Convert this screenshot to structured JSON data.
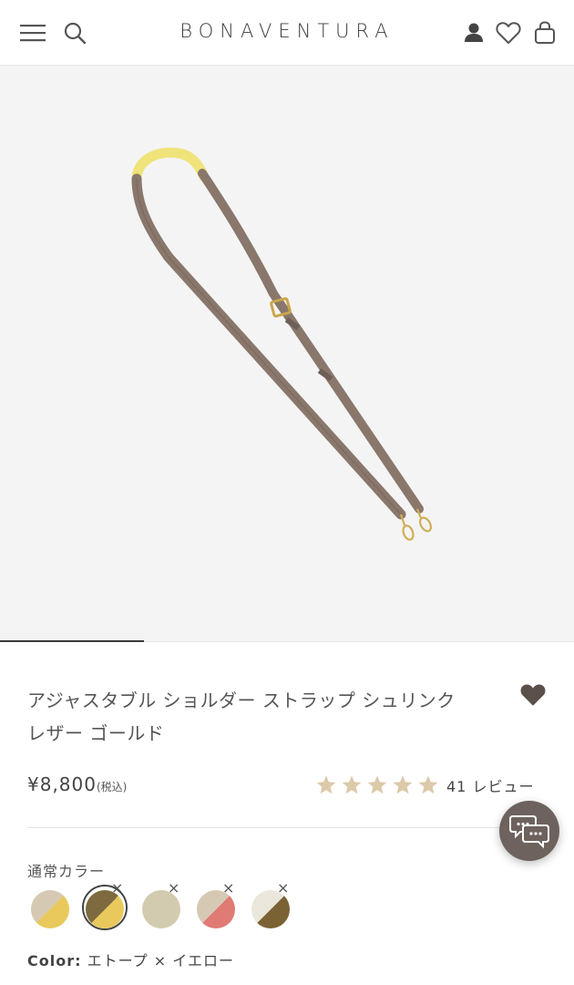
{
  "header": {
    "brand": "BONAVENTURA",
    "icons": [
      "menu-icon",
      "search-icon",
      "account-icon",
      "heart-icon",
      "bag-icon"
    ]
  },
  "gallery": {
    "image_alt": "shoulder strap in etoupe with yellow lining",
    "progress": 0.25
  },
  "product": {
    "title_line1": "アジャスタブル ショルダー ストラップ シュリンク",
    "title_line2": "レザー ゴールド",
    "price": "¥8,800",
    "tax_note": "(税込)",
    "rating": 5,
    "review_count": "41",
    "review_label": "レビュー"
  },
  "colors": {
    "section_label": "通常カラー",
    "selected_prefix": "Color:",
    "selected_name": "エトープ × イエロー",
    "swatches": [
      {
        "a": "#d6c9b4",
        "b": "#e9c95b",
        "sold_out": false,
        "selected": false
      },
      {
        "a": "#7d6a3f",
        "b": "#e9c95b",
        "sold_out": true,
        "selected": true
      },
      {
        "a": "#d3cbaf",
        "b": "#d3cbaf",
        "sold_out": true,
        "selected": false
      },
      {
        "a": "#d6c9b4",
        "b": "#e07a74",
        "sold_out": true,
        "selected": false
      },
      {
        "a": "#ece7dc",
        "b": "#7b6234",
        "sold_out": true,
        "selected": false
      }
    ]
  },
  "theme": {
    "star_color": "#dcc9a9",
    "chat_bg": "#6d625d",
    "strap_color": "#8a776c",
    "lining_color": "#f1e67d"
  }
}
